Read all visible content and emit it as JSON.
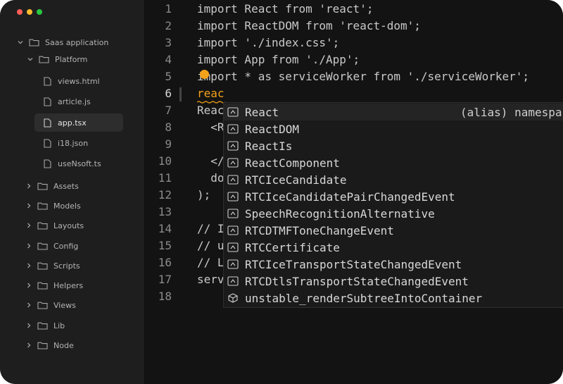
{
  "window": {
    "traffic_colors": [
      "#ff5f57",
      "#febc2e",
      "#28c840"
    ]
  },
  "sidebar": {
    "root": "Saas application",
    "platform": "Platform",
    "files": [
      "views.html",
      "article.js",
      "app.tsx",
      "i18.json",
      "useNsoft.ts"
    ],
    "active_file": "app.tsx",
    "folders": [
      "Assets",
      "Models",
      "Layouts",
      "Config",
      "Scripts",
      "Helpers",
      "Views",
      "Lib",
      "Node"
    ]
  },
  "editor": {
    "line_numbers": [
      "1",
      "2",
      "3",
      "4",
      "5",
      "6",
      "7",
      "8",
      "9",
      "10",
      "11",
      "12",
      "13",
      "14",
      "15",
      "16",
      "17",
      "18"
    ],
    "lines": [
      "import React from 'react';",
      "import ReactDOM from 'react-dom';",
      "import './index.css';",
      "import App from './App';",
      "import * as serviceWorker from './serviceWorker';",
      "reac",
      "Reac",
      "  <R",
      "  ",
      "  </",
      "  do",
      ");",
      "",
      "// I",
      "// u",
      "// L",
      "serv",
      ""
    ],
    "accent": "#f3a21b"
  },
  "autocomplete": {
    "detail": "(alias) namespace",
    "items": [
      {
        "label": "React",
        "icon": "namespace-icon"
      },
      {
        "label": "ReactDOM",
        "icon": "namespace-icon"
      },
      {
        "label": "ReactIs",
        "icon": "namespace-icon"
      },
      {
        "label": "ReactComponent",
        "icon": "namespace-icon"
      },
      {
        "label": "RTCIceCandidate",
        "icon": "namespace-icon"
      },
      {
        "label": "RTCIceCandidatePairChangedEvent",
        "icon": "namespace-icon"
      },
      {
        "label": "SpeechRecognitionAlternative",
        "icon": "namespace-icon"
      },
      {
        "label": "RTCDTMFToneChangeEvent",
        "icon": "namespace-icon"
      },
      {
        "label": "RTCCertificate",
        "icon": "namespace-icon"
      },
      {
        "label": "RTCIceTransportStateChangedEvent",
        "icon": "namespace-icon"
      },
      {
        "label": "RTCDtlsTransportStateChangedEvent",
        "icon": "namespace-icon"
      },
      {
        "label": "unstable_renderSubtreeIntoContainer",
        "icon": "cube-icon"
      }
    ]
  }
}
